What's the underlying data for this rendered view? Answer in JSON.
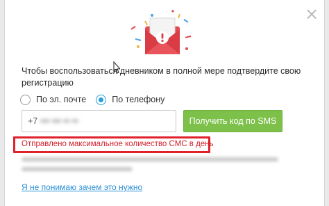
{
  "dialog": {
    "close_symbol": "×",
    "headline": "Чтобы воспользоваться дневником в полной мере подтвердите свою регистрацию"
  },
  "verify_method": {
    "options": [
      {
        "label": "По эл. почте",
        "checked": false
      },
      {
        "label": "По телефону",
        "checked": true
      }
    ]
  },
  "phone": {
    "prefix": "+7",
    "value_obscured": "••• ••• •• ••"
  },
  "buttons": {
    "get_code": "Получить код по SMS"
  },
  "error": {
    "message": "Отправлено максимальное количество СМС в день"
  },
  "links": {
    "help": "Я не понимаю зачем это нужно"
  },
  "colors": {
    "accent_green": "#7dc04a",
    "error_red": "#e0202a",
    "link_blue": "#2a8fd8",
    "envelope_red": "#e34a52"
  },
  "icons": {
    "envelope": "envelope-alert-icon",
    "close": "close-icon",
    "cursor": "mouse-cursor-icon"
  }
}
